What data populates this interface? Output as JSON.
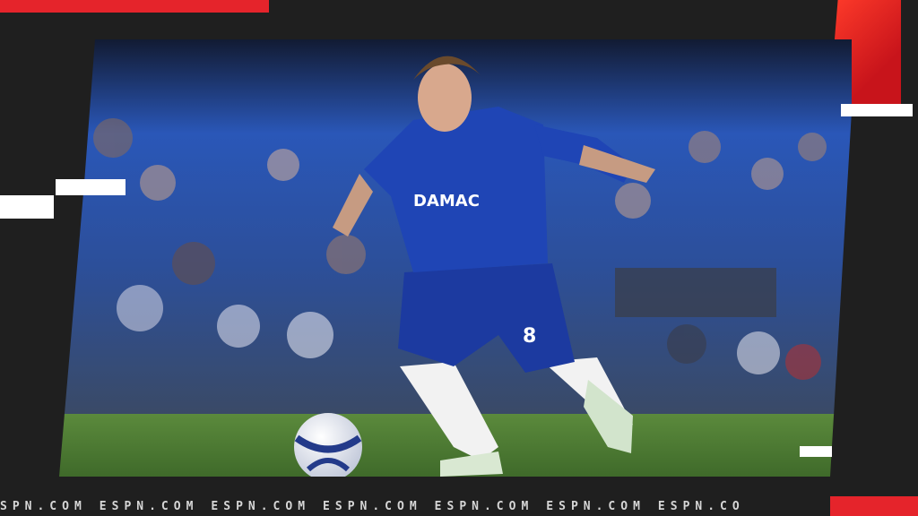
{
  "photo": {
    "description_label": "Chelsea player dribbling ball",
    "shirt_sponsor": "DAMAC",
    "shirt_number": "8"
  },
  "footer": {
    "repeating_text": [
      "SPN.COM",
      "ESPN.COM",
      "ESPN.COM",
      "ESPN.COM",
      "ESPN.COM",
      "ESPN.COM",
      "ESPN.CO"
    ]
  },
  "colors": {
    "background": "#1f1f1f",
    "accent_red": "#e5242b",
    "kit_blue": "#1f3fa8",
    "pitch_green": "#4f7a35"
  }
}
